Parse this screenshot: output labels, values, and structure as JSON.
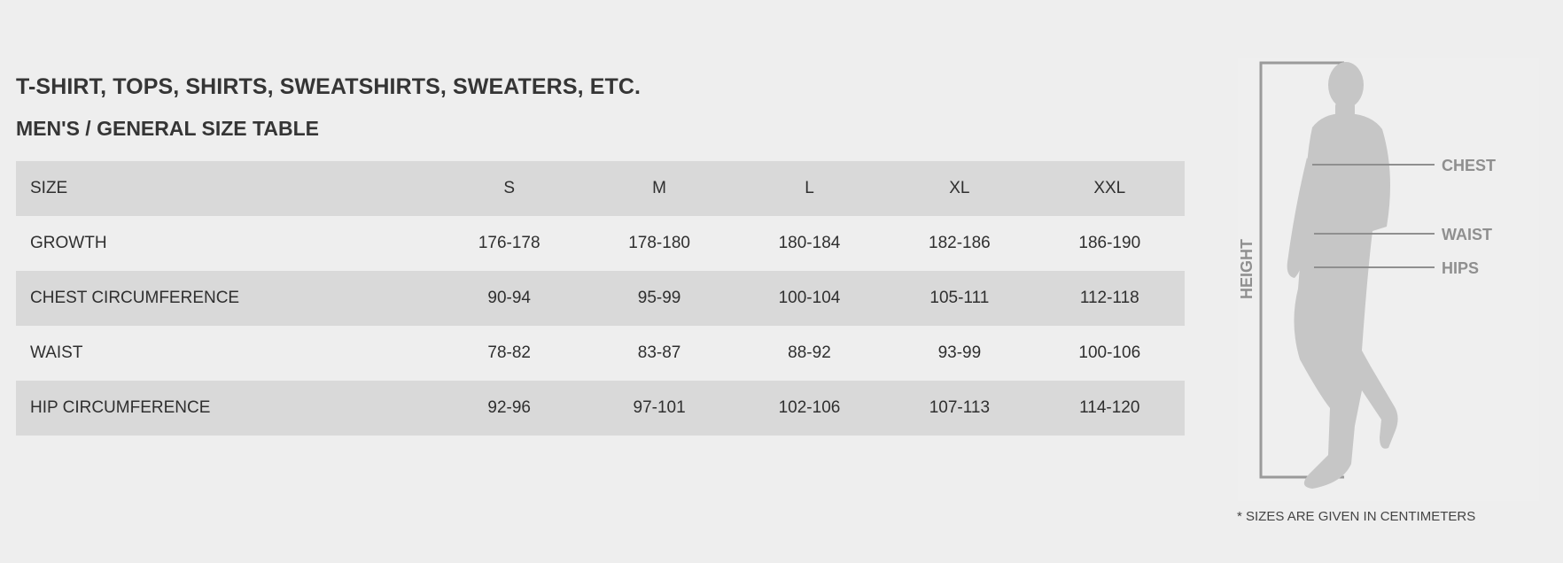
{
  "page": {
    "title": "T-SHIRT, TOPS, SHIRTS, SWEATSHIRTS, SWEATERS, ETC.",
    "subtitle": "MEN'S / GENERAL SIZE TABLE"
  },
  "table": {
    "columns": [
      "SIZE",
      "S",
      "M",
      "L",
      "XL",
      "XXL"
    ],
    "rows": [
      {
        "label": "GROWTH",
        "values": [
          "176-178",
          "178-180",
          "180-184",
          "182-186",
          "186-190"
        ]
      },
      {
        "label": "CHEST CIRCUMFERENCE",
        "values": [
          "90-94",
          "95-99",
          "100-104",
          "105-111",
          "112-118"
        ]
      },
      {
        "label": "WAIST",
        "values": [
          "78-82",
          "83-87",
          "88-92",
          "93-99",
          "100-106"
        ]
      },
      {
        "label": "HIP CIRCUMFERENCE",
        "values": [
          "92-96",
          "97-101",
          "102-106",
          "107-113",
          "114-120"
        ]
      }
    ]
  },
  "figure": {
    "height_label": "HEIGHT",
    "chest_label": "CHEST",
    "waist_label": "WAIST",
    "hips_label": "HIPS"
  },
  "note": "* SIZES ARE GIVEN IN CENTIMETERS",
  "colors": {
    "background": "#eeeeee",
    "row_shade": "#d9d9d9",
    "silhouette": "#c6c6c6",
    "measure_line": "#8f8f8f"
  }
}
